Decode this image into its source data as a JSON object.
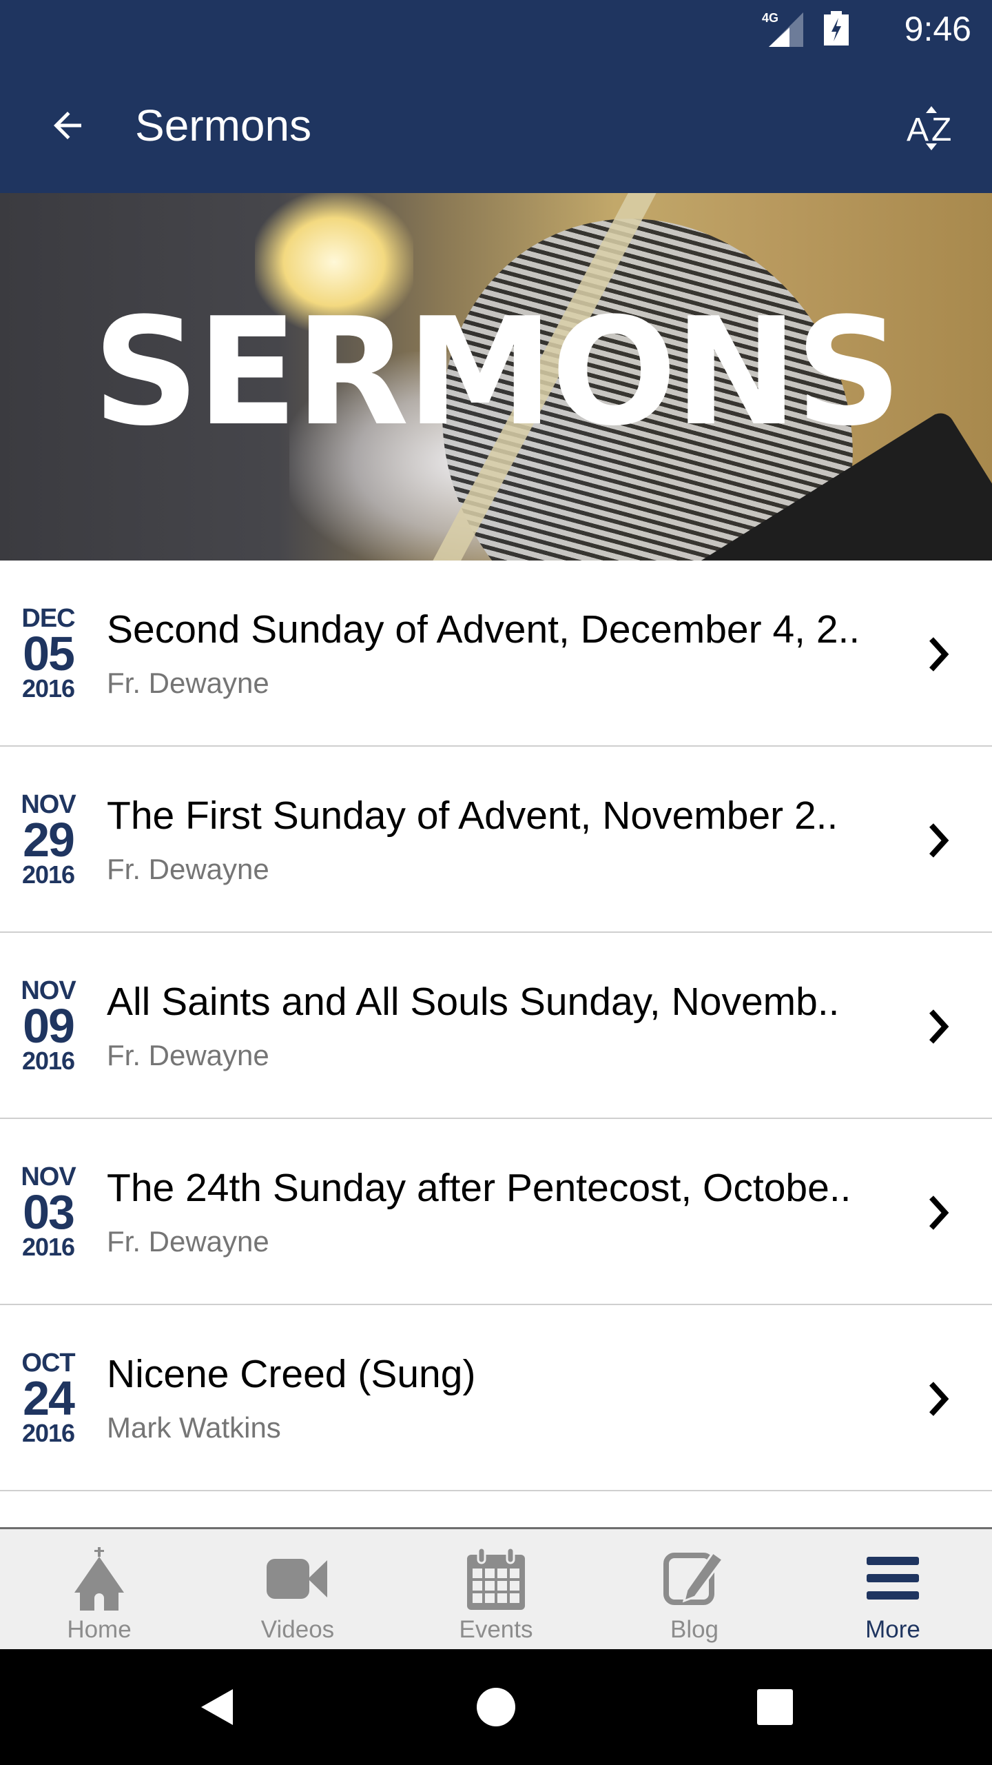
{
  "status_bar": {
    "network": "4G",
    "time": "9:46",
    "icons": [
      "signal-icon",
      "battery-charging-icon"
    ]
  },
  "app_bar": {
    "title": "Sermons",
    "back_icon": "arrow-back-icon",
    "sort_icon": "sort-az-icon"
  },
  "banner": {
    "text": "SERMONS"
  },
  "sermons": [
    {
      "month": "DEC",
      "day": "05",
      "year": "2016",
      "title": "Second Sunday of Advent, December 4, 2..",
      "author": "Fr. Dewayne"
    },
    {
      "month": "NOV",
      "day": "29",
      "year": "2016",
      "title": "The First Sunday of Advent, November 2..",
      "author": "Fr. Dewayne"
    },
    {
      "month": "NOV",
      "day": "09",
      "year": "2016",
      "title": "All Saints and All Souls Sunday, Novemb..",
      "author": "Fr. Dewayne"
    },
    {
      "month": "NOV",
      "day": "03",
      "year": "2016",
      "title": "The 24th Sunday after Pentecost, Octobe..",
      "author": "Fr. Dewayne"
    },
    {
      "month": "OCT",
      "day": "24",
      "year": "2016",
      "title": "Nicene Creed (Sung)",
      "author": "Mark Watkins"
    }
  ],
  "tab_bar": {
    "tabs": [
      {
        "label": "Home",
        "icon": "church-icon",
        "active": false
      },
      {
        "label": "Videos",
        "icon": "video-camera-icon",
        "active": false
      },
      {
        "label": "Events",
        "icon": "calendar-icon",
        "active": false
      },
      {
        "label": "Blog",
        "icon": "edit-icon",
        "active": false
      },
      {
        "label": "More",
        "icon": "menu-icon",
        "active": true
      }
    ]
  },
  "nav_bar": {
    "buttons": [
      "back-triangle-icon",
      "home-circle-icon",
      "recents-square-icon"
    ]
  },
  "colors": {
    "primary": "#1f3560",
    "inactive": "#8c8c8c",
    "subtitle": "#757575",
    "divider": "#cfcfcf",
    "tab_bg": "#efefef"
  }
}
